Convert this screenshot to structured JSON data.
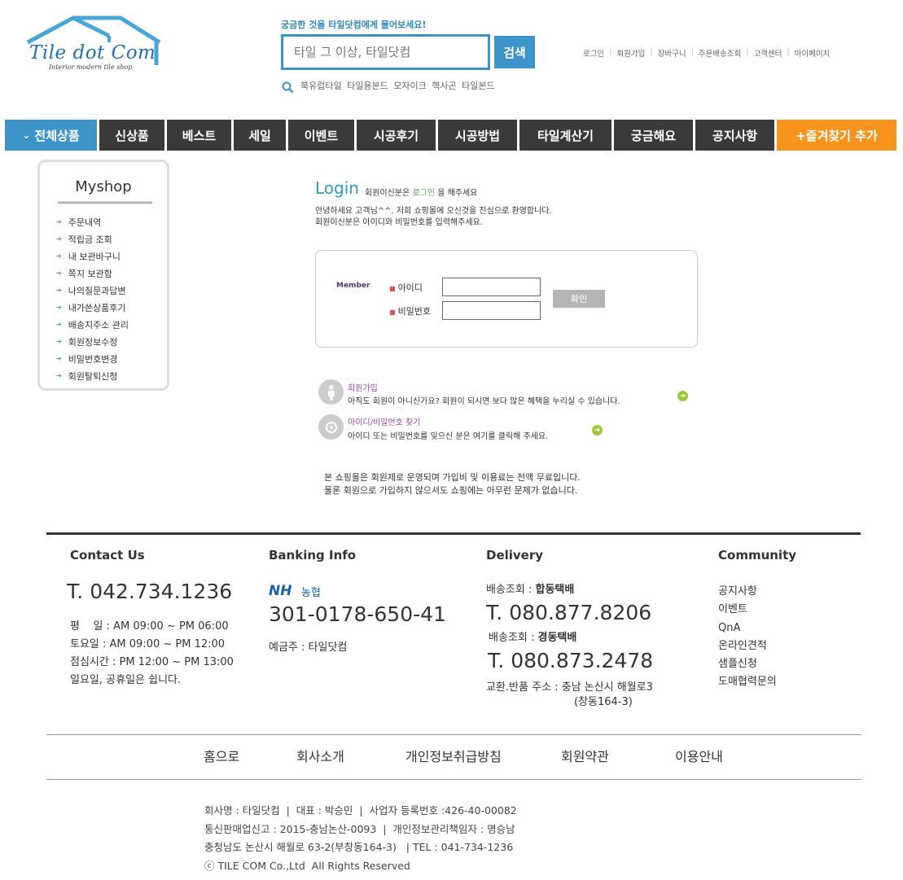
{
  "logo": {
    "title": "Tile dot Com",
    "subtitle": "Interior modern tile shop"
  },
  "search": {
    "tagline": "궁금한 것을 타일닷컴에게 물어보세요!",
    "placeholder": "타일 그 이상, 타일닷컴",
    "button": "검색",
    "keywords": [
      "북유럽타일",
      "타일용본드",
      "모자이크",
      "핵사곤",
      "타일본드"
    ]
  },
  "toplinks": [
    "로그인",
    "회원가입",
    "장바구니",
    "주문배송조회",
    "고객센터",
    "마이페이지"
  ],
  "nav": {
    "all": "전체상품",
    "items": [
      "신상품",
      "베스트",
      "세일",
      "이벤트",
      "시공후기",
      "시공방법",
      "타일계산기",
      "궁금해요",
      "공지사항"
    ],
    "favorite": "+즐겨찾기 추가"
  },
  "myshop": {
    "title": "Myshop",
    "items": [
      "주문내역",
      "적립금 조회",
      "내 보관바구니",
      "쪽지 보관함",
      "나의질문과답변",
      "내가쓴상품후기",
      "배송지주소 관리",
      "회원정보수정",
      "비밀번호변경",
      "회원탈퇴신청"
    ]
  },
  "login": {
    "title": "Login",
    "sub_prefix": "회원이신분은",
    "sub_link": "로그인",
    "sub_suffix": "을 해주세요",
    "desc1": "안녕하세요 고객님^^. 저희 쇼핑몰에 오신것을 진심으로 환영합니다.",
    "desc2": "회원이신분은 아이디와 비밀번호를 입력해주세요.",
    "member_label": "Member",
    "id_label": "아이디",
    "pw_label": "비밀번호",
    "id_value": "",
    "pw_value": "",
    "confirm": "확인",
    "join_title": "회원가입",
    "join_desc": "아직도 회원이 아니신가요? 회원이 되시면 보다 많은 혜택을 누리실 수 있습니다.",
    "find_title": "아이디/비밀번호 찾기",
    "find_desc": "아이디 또는 비밀번호를 잊으신 분은 여기를 클릭해 주세요.",
    "notice1": "본 쇼핑몰은 회원제로 운영되며 가입비 및 이용료는 전액 무료입니다.",
    "notice2": "물론 회원으로 가입하지 않으셔도 쇼핑에는 아무런 문제가 없습니다."
  },
  "footer": {
    "contact": {
      "title": "Contact Us",
      "phone": "T. 042.734.1236",
      "hours": [
        "평    일 : AM 09:00 ~ PM 06:00",
        "토요일 : AM 09:00 ~ PM 12:00",
        "점심시간 : PM 12:00 ~ PM 13:00",
        "일요일, 공휴일은 쉽니다."
      ]
    },
    "banking": {
      "title": "Banking Info",
      "bank_logo": "NH",
      "bank_name": "농협",
      "account": "301-0178-650-41",
      "holder": "예금주 : 타일닷컴"
    },
    "delivery": {
      "title": "Delivery",
      "carrier1_label": "배송조회 :",
      "carrier1": "합동택배",
      "phone1": "T. 080.877.8206",
      "carrier2_label": "배송조회 :",
      "carrier2": "경동택배",
      "phone2": "T. 080.873.2478",
      "return_label": "교환.반품 주소 :",
      "return_addr1": "충남 논산시 해월로3",
      "return_addr2": "(창동164-3)"
    },
    "community": {
      "title": "Community",
      "items": [
        "공지사항",
        "이벤트",
        "QnA",
        "온라인견적",
        "샘플신청",
        "도매협력문의"
      ]
    },
    "links": [
      "홈으로",
      "회사소개",
      "개인정보취급방침",
      "회원약관",
      "이용안내"
    ],
    "company": [
      "회사명 : 타일닷컴  |  대표 : 박승민  |  사업자 등록번호 :426-40-00082",
      "통신판매업신고 : 2015-충남논산-0093  |  개인정보관리책임자 : 명승남",
      "충청남도 논산시 해월로 63-2(부창동164-3)   | TEL : 041-734-1236",
      "ⓒ TILE COM Co.,Ltd  All Rights Reserved"
    ]
  },
  "colors": {
    "accent": "#3d94c8",
    "nav_dark": "#3a3a3a",
    "favorite": "#f7941d",
    "login_title": "#2d9cc0"
  }
}
